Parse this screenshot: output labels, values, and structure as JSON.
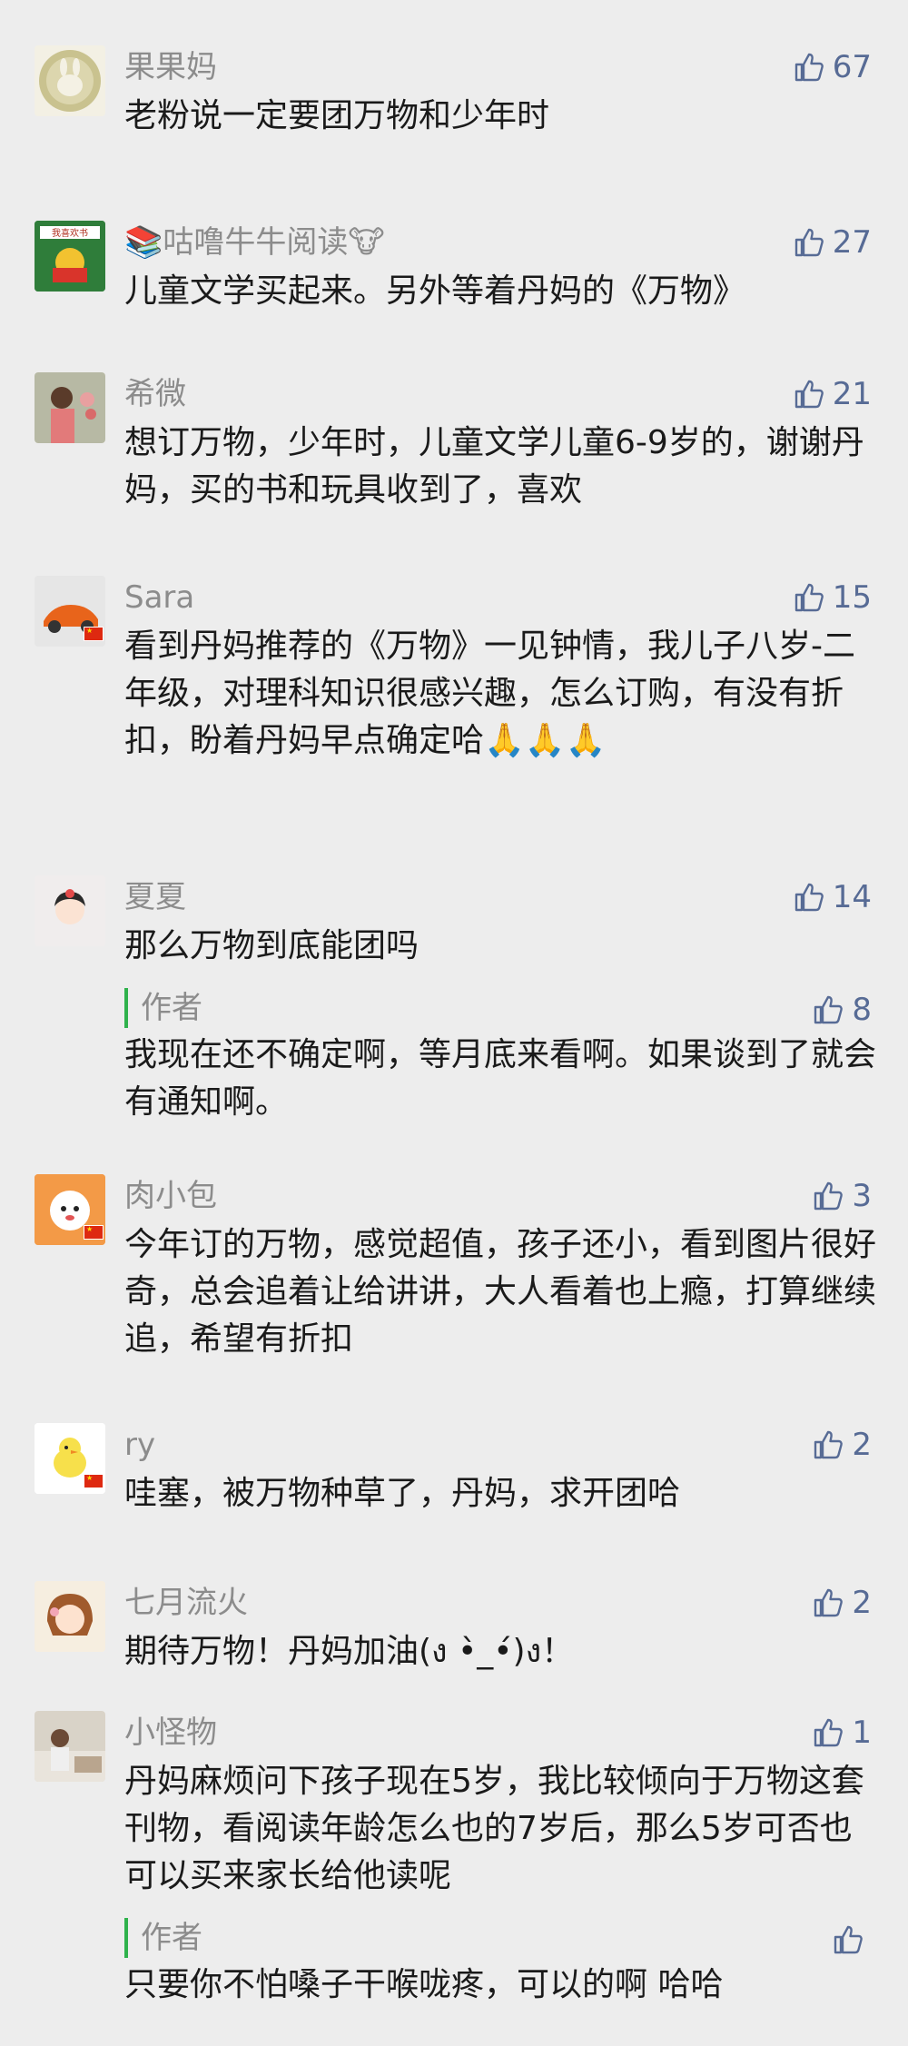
{
  "comments": [
    {
      "name": "果果妈",
      "likes": "67",
      "text": "老粉说一定要团万物和少年时"
    },
    {
      "name": "📚咕噜牛牛阅读🐮",
      "likes": "27",
      "text": "儿童文学买起来。另外等着丹妈的《万物》"
    },
    {
      "name": "希微",
      "likes": "21",
      "text": "想订万物，少年时，儿童文学儿童6-9岁的，谢谢丹妈，买的书和玩具收到了，喜欢"
    },
    {
      "name": "Sara",
      "likes": "15",
      "text": "看到丹妈推荐的《万物》一见钟情，我儿子八岁-二年级，对理科知识很感兴趣，怎么订购，有没有折扣，盼着丹妈早点确定哈🙏🙏🙏"
    },
    {
      "name": "夏夏",
      "likes": "14",
      "text": "那么万物到底能团吗",
      "reply": {
        "label": "作者",
        "likes": "8",
        "text": "我现在还不确定啊，等月底来看啊。如果谈到了就会有通知啊。"
      }
    },
    {
      "name": "肉小包",
      "likes": "3",
      "text": "今年订的万物，感觉超值，孩子还小，看到图片很好奇，总会追着让给讲讲，大人看着也上瘾，打算继续追，希望有折扣"
    },
    {
      "name": "ry",
      "likes": "2",
      "text": "哇塞，被万物种草了，丹妈，求开团哈"
    },
    {
      "name": "七月流火",
      "likes": "2",
      "text": "期待万物！丹妈加油(ง •̀_•́)ง！"
    },
    {
      "name": "小怪物",
      "likes": "1",
      "text": "丹妈麻烦问下孩子现在5岁，我比较倾向于万物这套刊物，看阅读年龄怎么也的7岁后，那么5岁可否也可以买来家长给他读呢",
      "reply": {
        "label": "作者",
        "likes": "",
        "text": "只要你不怕嗓子干喉咙疼，可以的啊 哈哈"
      }
    }
  ],
  "avatar_sign_text": "我喜欢书"
}
